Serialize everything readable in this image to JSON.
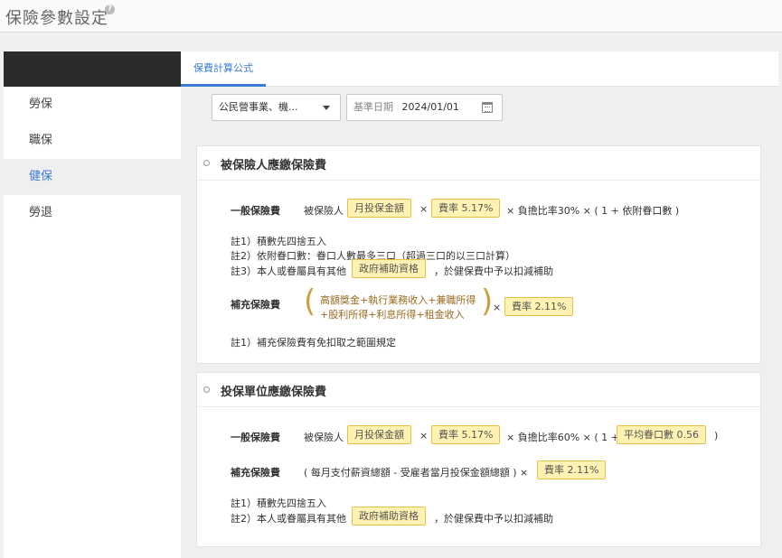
{
  "page": {
    "title": "保險參數設定",
    "help_icon": "?"
  },
  "sidebar": {
    "items": [
      {
        "label": "勞保",
        "active": false
      },
      {
        "label": "職保",
        "active": false
      },
      {
        "label": "健保",
        "active": true
      },
      {
        "label": "勞退",
        "active": false
      }
    ]
  },
  "tabs": [
    {
      "label": "保費計算公式",
      "active": true
    }
  ],
  "filters": {
    "category_select": "公民營事業、機...",
    "date_label": "基準日期",
    "date_value": "2024/01/01"
  },
  "insured": {
    "title": "被保險人應繳保險費",
    "general": {
      "label": "一般保險費",
      "prefix": "被保險人",
      "chip_salary": "月投保金額",
      "times": "×",
      "chip_rate": "費率 5.17%",
      "suffix": "× 負擔比率30% × ( 1 + 依附眷口數 )"
    },
    "notes": [
      "註1）積數先四捨五入",
      "註2）依附眷口數：眷口人數最多三口（超過三口的以三口計算）",
      "註3）本人或眷屬具有其他"
    ],
    "note3_chip": "政府補助資格",
    "note3_suffix": "，於健保費中予以扣減補助",
    "supplementary": {
      "label": "補充保險費",
      "line1": "高額獎金+執行業務收入+兼職所得",
      "line2": "+股利所得+利息所得+租金收入",
      "times": "×",
      "chip_rate": "費率 2.11%"
    },
    "supp_note": "註1）補充保險費有免扣取之範圍規定"
  },
  "employer": {
    "title": "投保單位應繳保險費",
    "general": {
      "label": "一般保險費",
      "prefix": "被保險人",
      "chip_salary": "月投保金額",
      "times": "×",
      "chip_rate": "費率 5.17%",
      "middle": "× 負擔比率60% × ( 1 +",
      "chip_dependents": "平均眷口數 0.56",
      "close": ")"
    },
    "supplementary": {
      "label": "補充保險費",
      "text": "( 每月支付薪資總額 - 受雇者當月投保金額總額 ) ×",
      "chip_rate": "費率 2.11%"
    },
    "notes": [
      "註1）積數先四捨五入",
      "註2）本人或眷屬具有其他"
    ],
    "note2_chip": "政府補助資格",
    "note2_suffix": "，於健保費中予以扣減補助"
  }
}
